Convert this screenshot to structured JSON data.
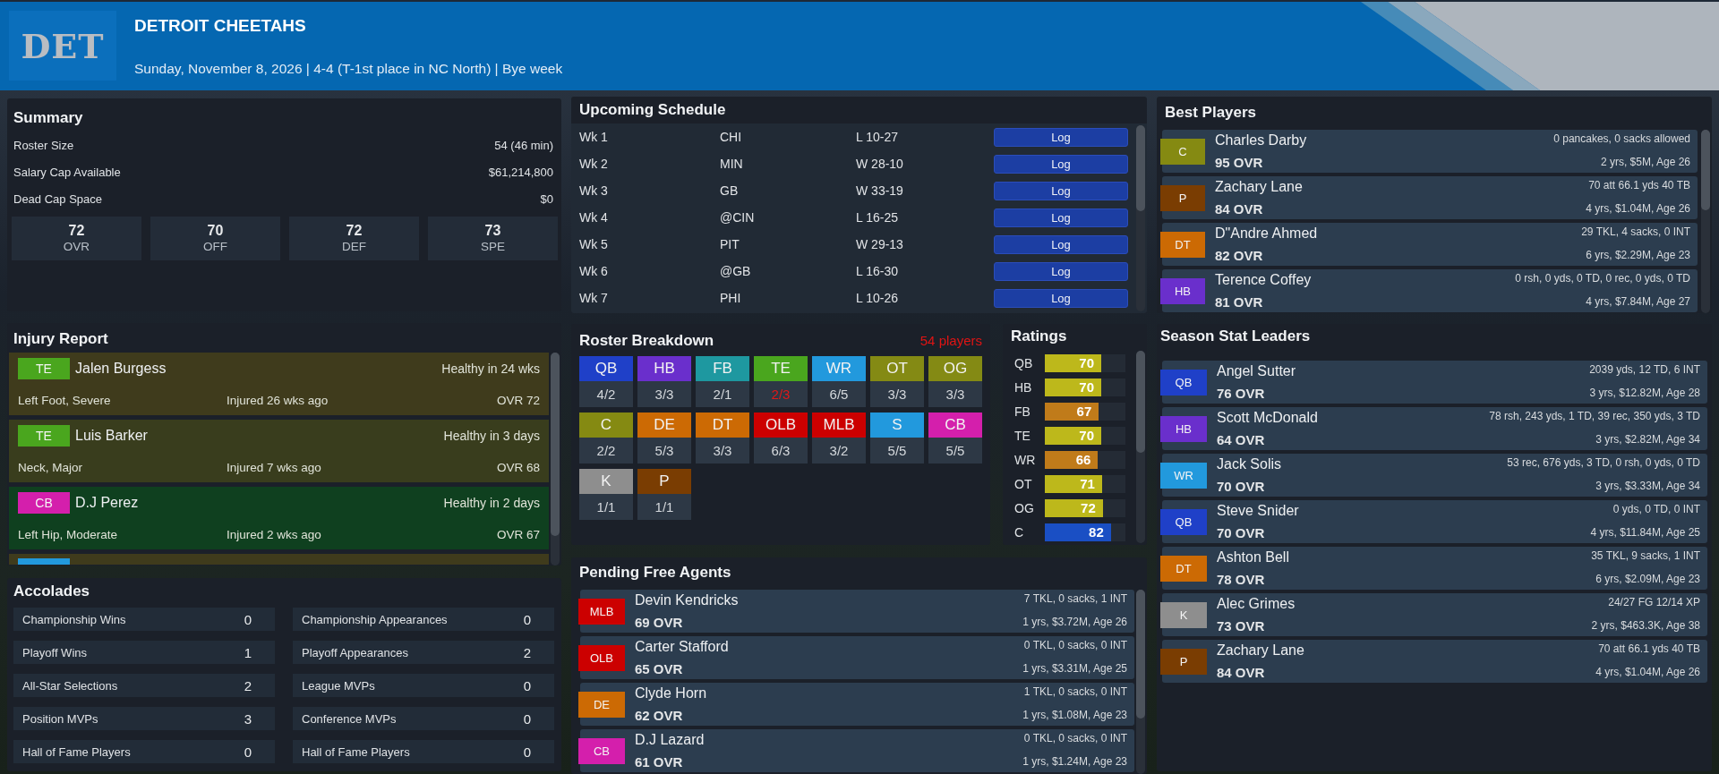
{
  "header": {
    "team_abbr": "DET",
    "team_name": "DETROIT CHEETAHS",
    "subtitle": "Sunday, November 8, 2026 | 4-4 (T-1st place in NC North) | Bye week"
  },
  "summary": {
    "title": "Summary",
    "rows": [
      {
        "label": "Roster Size",
        "value": "54 (46 min)"
      },
      {
        "label": "Salary Cap Available",
        "value": "$61,214,800"
      },
      {
        "label": "Dead Cap Space",
        "value": "$0"
      }
    ],
    "ratings": [
      {
        "value": "72",
        "label": "OVR"
      },
      {
        "value": "70",
        "label": "OFF"
      },
      {
        "value": "72",
        "label": "DEF"
      },
      {
        "value": "73",
        "label": "SPE"
      }
    ]
  },
  "schedule": {
    "title": "Upcoming Schedule",
    "games": [
      {
        "week": "Wk 1",
        "opponent": "CHI",
        "result": "L 10-27",
        "button": "Log"
      },
      {
        "week": "Wk 2",
        "opponent": "MIN",
        "result": "W 28-10",
        "button": "Log"
      },
      {
        "week": "Wk 3",
        "opponent": "GB",
        "result": "W 33-19",
        "button": "Log"
      },
      {
        "week": "Wk 4",
        "opponent": "@CIN",
        "result": "L 16-25",
        "button": "Log"
      },
      {
        "week": "Wk 5",
        "opponent": "PIT",
        "result": "W 29-13",
        "button": "Log"
      },
      {
        "week": "Wk 6",
        "opponent": "@GB",
        "result": "L 16-30",
        "button": "Log"
      },
      {
        "week": "Wk 7",
        "opponent": "PHI",
        "result": "L 10-26",
        "button": "Log"
      }
    ]
  },
  "best_players": {
    "title": "Best Players",
    "players": [
      {
        "position": "C",
        "color": "#858a12",
        "name": "Charles Darby",
        "ovr": "95 OVR",
        "stats": "0 pancakes, 0 sacks allowed",
        "contract": "2 yrs, $5M, Age 26"
      },
      {
        "position": "P",
        "color": "#7a3d02",
        "name": "Zachary Lane",
        "ovr": "84 OVR",
        "stats": "70 att 66.1 yds 40 TB",
        "contract": "4 yrs, $1.04M, Age 26"
      },
      {
        "position": "DT",
        "color": "#cc6a04",
        "name": "D\"Andre Ahmed",
        "ovr": "82 OVR",
        "stats": "29 TKL, 4 sacks, 0 INT",
        "contract": "6 yrs, $2.29M, Age 23"
      },
      {
        "position": "HB",
        "color": "#6a2fcc",
        "name": "Terence Coffey",
        "ovr": "81 OVR",
        "stats": "0 rsh, 0 yds, 0 TD, 0 rec, 0 yds, 0 TD",
        "contract": "4 yrs, $7.84M, Age 27"
      }
    ]
  },
  "injury_report": {
    "title": "Injury Report",
    "injuries": [
      {
        "color": "#3f3b1c",
        "badge": {
          "label": "TE",
          "color": "#4aa61e"
        },
        "name": "Jalen Burgess",
        "recovery": "Healthy in 24 wks",
        "injury": "Left Foot, Severe",
        "since": "Injured 26 wks ago",
        "ovr": "OVR 72"
      },
      {
        "color": "#393d1d",
        "badge": {
          "label": "TE",
          "color": "#4aa61e"
        },
        "name": "Luis Barker",
        "recovery": "Healthy in 3 days",
        "injury": "Neck, Major",
        "since": "Injured 7 wks ago",
        "ovr": "OVR 68"
      },
      {
        "color": "#0f401f",
        "badge": {
          "label": "CB",
          "color": "#d41fac"
        },
        "name": "D.J Perez",
        "recovery": "Healthy in 2 days",
        "injury": "Left Hip, Moderate",
        "since": "Injured 2 wks ago",
        "ovr": "OVR 67"
      },
      {
        "color": "#3f3b1c",
        "badge": {
          "color": "#2299dd"
        }
      }
    ]
  },
  "roster_breakdown": {
    "title": "Roster Breakdown",
    "total": "54 players",
    "positions": [
      {
        "position": "QB",
        "color": "#1f40c8",
        "count": "4/2",
        "short": false
      },
      {
        "position": "HB",
        "color": "#6a2fcc",
        "count": "3/3",
        "short": false
      },
      {
        "position": "FB",
        "color": "#1e98a0",
        "count": "2/1",
        "short": false
      },
      {
        "position": "TE",
        "color": "#4aa61e",
        "count": "2/3",
        "short": true
      },
      {
        "position": "WR",
        "color": "#2299dd",
        "count": "6/5",
        "short": false
      },
      {
        "position": "OT",
        "color": "#848a14",
        "count": "3/3",
        "short": false
      },
      {
        "position": "OG",
        "color": "#848a14",
        "count": "3/3",
        "short": false
      },
      {
        "position": "C",
        "color": "#858a12",
        "count": "2/2",
        "short": false
      },
      {
        "position": "DE",
        "color": "#cc6a04",
        "count": "5/3",
        "short": false
      },
      {
        "position": "DT",
        "color": "#cc6a04",
        "count": "3/3",
        "short": false
      },
      {
        "position": "OLB",
        "color": "#cc0000",
        "count": "6/3",
        "short": false
      },
      {
        "position": "MLB",
        "color": "#cc0000",
        "count": "3/2",
        "short": false
      },
      {
        "position": "S",
        "color": "#2299dd",
        "count": "5/5",
        "short": false
      },
      {
        "position": "CB",
        "color": "#d41fac",
        "count": "5/5",
        "short": false
      },
      {
        "position": "K",
        "color": "#8e8e8e",
        "count": "1/1",
        "short": false
      },
      {
        "position": "P",
        "color": "#7a3d02",
        "count": "1/1",
        "short": false
      }
    ]
  },
  "ratings": {
    "title": "Ratings",
    "rows": [
      {
        "position": "QB",
        "value": "70",
        "level": 0.7,
        "color": "#bdb81b"
      },
      {
        "position": "HB",
        "value": "70",
        "level": 0.7,
        "color": "#bdb81b"
      },
      {
        "position": "FB",
        "value": "67",
        "level": 0.67,
        "color": "#c07b1a"
      },
      {
        "position": "TE",
        "value": "70",
        "level": 0.7,
        "color": "#bdb81b"
      },
      {
        "position": "WR",
        "value": "66",
        "level": 0.66,
        "color": "#c07b1a"
      },
      {
        "position": "OT",
        "value": "71",
        "level": 0.71,
        "color": "#bdb81b"
      },
      {
        "position": "OG",
        "value": "72",
        "level": 0.72,
        "color": "#bdb81b"
      },
      {
        "position": "C",
        "value": "82",
        "level": 0.82,
        "color": "#1a4fc4"
      }
    ]
  },
  "season_stat_leaders": {
    "title": "Season Stat Leaders",
    "players": [
      {
        "position": "QB",
        "color": "#1f40c8",
        "name": "Angel Sutter",
        "ovr": "76 OVR",
        "stats": "2039 yds, 12 TD, 6 INT",
        "contract": "3 yrs, $12.82M, Age 28"
      },
      {
        "position": "HB",
        "color": "#6a2fcc",
        "name": "Scott McDonald",
        "ovr": "64 OVR",
        "stats": "78 rsh, 243 yds, 1 TD, 39 rec, 350 yds, 3 TD",
        "contract": "3 yrs, $2.82M, Age 34"
      },
      {
        "position": "WR",
        "color": "#2299dd",
        "name": "Jack Solis",
        "ovr": "70 OVR",
        "stats": "53 rec, 676 yds, 3 TD, 0 rsh, 0 yds, 0 TD",
        "contract": "3 yrs, $3.33M, Age 34"
      },
      {
        "position": "QB",
        "color": "#1f40c8",
        "name": "Steve Snider",
        "ovr": "70 OVR",
        "stats": "0 yds, 0 TD, 0 INT",
        "contract": "4 yrs, $11.84M, Age 25"
      },
      {
        "position": "DT",
        "color": "#cc6a04",
        "name": "Ashton Bell",
        "ovr": "78 OVR",
        "stats": "35 TKL, 9 sacks, 1 INT",
        "contract": "6 yrs, $2.09M, Age 23"
      },
      {
        "position": "K",
        "color": "#8e8e8e",
        "name": "Alec Grimes",
        "ovr": "73 OVR",
        "stats": "24/27 FG 12/14 XP",
        "contract": "2 yrs, $463.3K, Age 38"
      },
      {
        "position": "P",
        "color": "#7a3d02",
        "name": "Zachary Lane",
        "ovr": "84 OVR",
        "stats": "70 att 66.1 yds 40 TB",
        "contract": "4 yrs, $1.04M, Age 26"
      }
    ]
  },
  "accolades": {
    "title": "Accolades",
    "items": [
      {
        "label": "Championship Wins",
        "value": "0"
      },
      {
        "label": "Championship Appearances",
        "value": "0"
      },
      {
        "label": "Playoff Wins",
        "value": "1"
      },
      {
        "label": "Playoff Appearances",
        "value": "2"
      },
      {
        "label": "All-Star Selections",
        "value": "2"
      },
      {
        "label": "League MVPs",
        "value": "0"
      },
      {
        "label": "Position MVPs",
        "value": "3"
      },
      {
        "label": "Conference MVPs",
        "value": "0"
      },
      {
        "label": "Hall of Fame Players",
        "value": "0"
      },
      {
        "label": "Hall of Fame Players",
        "value": "0"
      }
    ]
  },
  "pending_free_agents": {
    "title": "Pending Free Agents",
    "players": [
      {
        "position": "MLB",
        "color": "#cc0000",
        "name": "Devin Kendricks",
        "ovr": "69 OVR",
        "stats": "7 TKL, 0 sacks, 1 INT",
        "contract": "1 yrs, $3.72M, Age 26"
      },
      {
        "position": "OLB",
        "color": "#cc0000",
        "name": "Carter Stafford",
        "ovr": "65 OVR",
        "stats": "0 TKL, 0 sacks, 0 INT",
        "contract": "1 yrs, $3.31M, Age 25"
      },
      {
        "position": "DE",
        "color": "#cc6a04",
        "name": "Clyde Horn",
        "ovr": "62 OVR",
        "stats": "1 TKL, 0 sacks, 0 INT",
        "contract": "1 yrs, $1.08M, Age 23"
      },
      {
        "position": "CB",
        "color": "#d41fac",
        "name": "D.J Lazard",
        "ovr": "61 OVR",
        "stats": "0 TKL, 0 sacks, 0 INT",
        "contract": "1 yrs, $1.24M, Age 23"
      }
    ]
  }
}
